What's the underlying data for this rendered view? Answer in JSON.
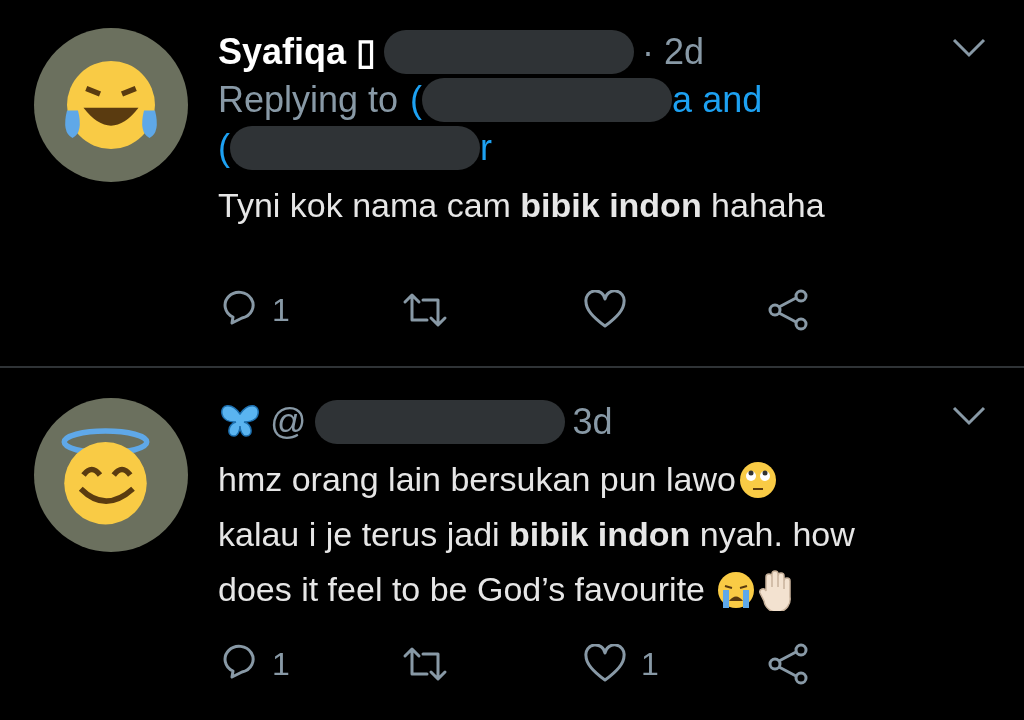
{
  "tweets": [
    {
      "avatar": {
        "kind": "laughing-tears"
      },
      "name_parts": [
        {
          "kind": "name",
          "text": "Syafiqa ▯"
        },
        {
          "kind": "redacted"
        },
        {
          "kind": "time",
          "text": "· 2d"
        }
      ],
      "reply_lines": [
        [
          {
            "kind": "label",
            "text": "Replying to"
          },
          {
            "kind": "link",
            "text": "("
          },
          {
            "kind": "redacted"
          },
          {
            "kind": "link",
            "text": "a and"
          }
        ],
        [
          {
            "kind": "link",
            "text": "("
          },
          {
            "kind": "redacted"
          },
          {
            "kind": "link",
            "text": "r"
          }
        ]
      ],
      "body": [
        [
          {
            "kind": "text",
            "text": "Tyni kok nama cam **bibik indon** hahaha"
          }
        ]
      ],
      "actions": [
        {
          "kind": "reply",
          "count": "1"
        },
        {
          "kind": "retweet"
        },
        {
          "kind": "like"
        },
        {
          "kind": "share"
        }
      ]
    },
    {
      "avatar": {
        "kind": "halo"
      },
      "name_parts": [
        {
          "kind": "butterfly"
        },
        {
          "kind": "handle",
          "text": "@"
        },
        {
          "kind": "redacted"
        },
        {
          "kind": "time",
          "text": "3d"
        }
      ],
      "body": [
        [
          {
            "kind": "text",
            "text": "hmz orang lain bersukan pun lawo"
          },
          {
            "kind": "rolling-eyes"
          }
        ],
        [
          {
            "kind": "text",
            "text": "kalau i je terus jadi **bibik indon** nyah. how"
          }
        ],
        [
          {
            "kind": "text",
            "text": "does it feel to be God’s favourite "
          },
          {
            "kind": "crying"
          },
          {
            "kind": "raised-hand"
          }
        ]
      ],
      "actions": [
        {
          "kind": "reply",
          "count": "1"
        },
        {
          "kind": "retweet"
        },
        {
          "kind": "like",
          "count": "1"
        },
        {
          "kind": "share"
        }
      ]
    }
  ]
}
